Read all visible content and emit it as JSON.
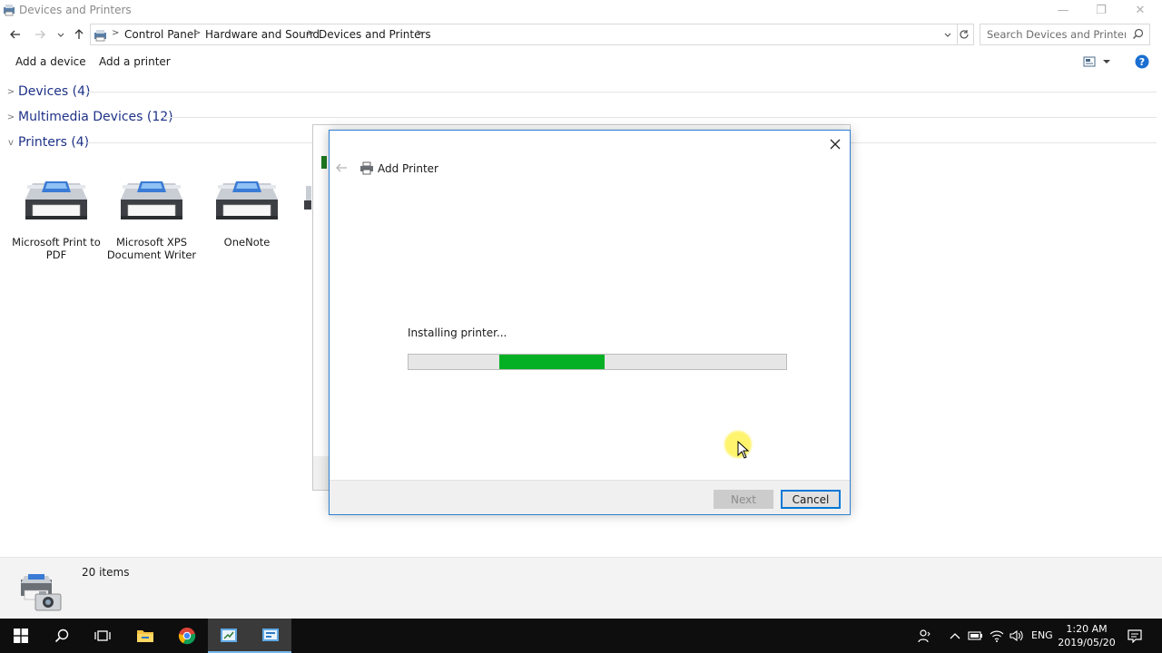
{
  "window": {
    "title": "Devices and Printers",
    "minimize_glyph": "—",
    "restore_glyph": "❐",
    "close_glyph": "✕"
  },
  "address": {
    "crumbs": [
      "Control Panel",
      "Hardware and Sound",
      "Devices and Printers"
    ],
    "search_placeholder": "Search Devices and Printers"
  },
  "commands": {
    "add_device": "Add a device",
    "add_printer": "Add a printer"
  },
  "groups": {
    "devices": "Devices (4)",
    "multimedia": "Multimedia Devices (12)",
    "printers": "Printers (4)"
  },
  "printers": [
    {
      "label": "Microsoft Print to PDF"
    },
    {
      "label": "Microsoft XPS Document Writer"
    },
    {
      "label": "OneNote"
    }
  ],
  "dialog": {
    "title": "Add Printer",
    "status": "Installing printer...",
    "progress_segment_start": 0.24,
    "progress_segment_end": 0.52,
    "next_label": "Next",
    "cancel_label": "Cancel"
  },
  "status_bar": {
    "item_count": "20 items"
  },
  "taskbar": {
    "language": "ENG",
    "time": "1:20 AM",
    "date": "2019/05/20"
  },
  "colors": {
    "progress_fill": "#06b025",
    "accent": "#0078d7",
    "group_title": "#1e3287"
  }
}
